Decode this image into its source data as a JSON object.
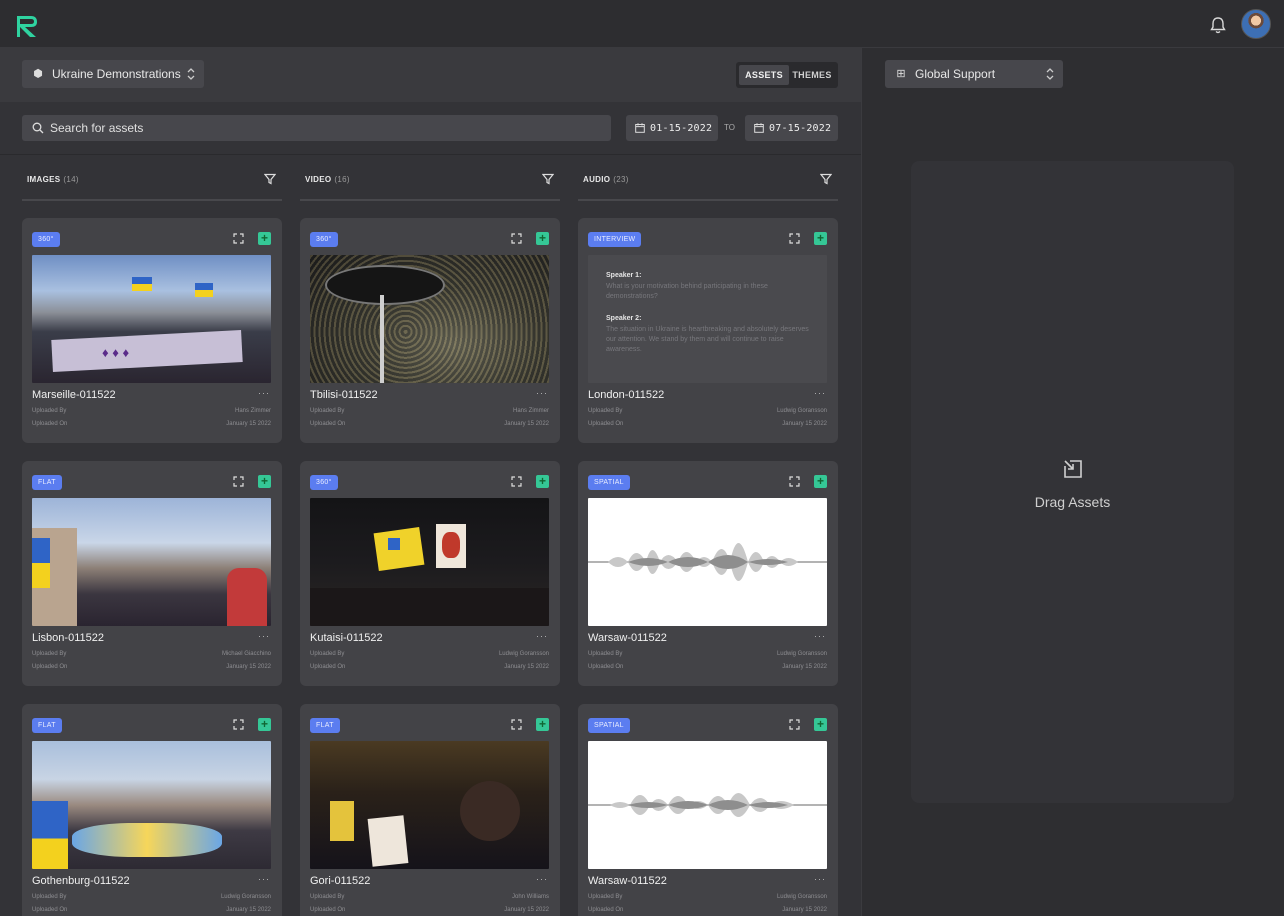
{
  "header": {
    "logo": "R",
    "bell_icon": "bell-icon",
    "avatar_icon": "user-avatar"
  },
  "project_select": {
    "value": "Ukraine Demonstrations",
    "icon": "cube-icon"
  },
  "view_toggle": {
    "assets": "ASSETS",
    "themes": "THEMES",
    "active": "assets"
  },
  "search": {
    "placeholder": "Search for assets"
  },
  "date_range": {
    "from": "01-15-2022",
    "to_label": "TO",
    "to": "07-15-2022"
  },
  "columns": [
    {
      "label": "IMAGES",
      "count": "(14)"
    },
    {
      "label": "VIDEO",
      "count": "(16)"
    },
    {
      "label": "AUDIO",
      "count": "(23)"
    }
  ],
  "meta_labels": {
    "uploaded_by": "Uploaded By",
    "uploaded_on": "Uploaded On"
  },
  "cards": [
    {
      "badge": "360°",
      "title": "Marseille-011522",
      "by": "Hans Zimmer",
      "on": "January 15 2022",
      "media": "photo-marseille"
    },
    {
      "badge": "360°",
      "title": "Tbilisi-011522",
      "by": "Hans Zimmer",
      "on": "January 15 2022",
      "media": "video-tbilisi"
    },
    {
      "badge": "INTERVIEW",
      "title": "London-011522",
      "by": "Ludwig Goransson",
      "on": "January 15 2022",
      "media": "transcript"
    },
    {
      "badge": "FLAT",
      "title": "Lisbon-011522",
      "by": "Michael Giacchino",
      "on": "January 15 2022",
      "media": "photo-lisbon"
    },
    {
      "badge": "360°",
      "title": "Kutaisi-011522",
      "by": "Ludwig Goransson",
      "on": "January 15 2022",
      "media": "video-kutaisi"
    },
    {
      "badge": "SPATIAL",
      "title": "Warsaw-011522",
      "by": "Ludwig Goransson",
      "on": "January 15 2022",
      "media": "waveform"
    },
    {
      "badge": "FLAT",
      "title": "Gothenburg-011522",
      "by": "Ludwig Goransson",
      "on": "January 15 2022",
      "media": "photo-gothenburg"
    },
    {
      "badge": "FLAT",
      "title": "Gori-011522",
      "by": "John Williams",
      "on": "January 15 2022",
      "media": "video-gori"
    },
    {
      "badge": "SPATIAL",
      "title": "Warsaw-011522",
      "by": "Ludwig Goransson",
      "on": "January 15 2022",
      "media": "waveform"
    }
  ],
  "transcript": {
    "speaker1": "Speaker 1:",
    "text1": "What is your motivation behind participating in these demonstrations?",
    "speaker2": "Speaker 2:",
    "text2": "The situation in Ukraine is heartbreaking and absolutely deserves our attention. We stand by them and will continue to raise awareness."
  },
  "workspace_select": {
    "value": "Global Support",
    "icon": "grid-icon"
  },
  "dropzone": {
    "label": "Drag Assets",
    "icon": "drag-in-icon"
  }
}
